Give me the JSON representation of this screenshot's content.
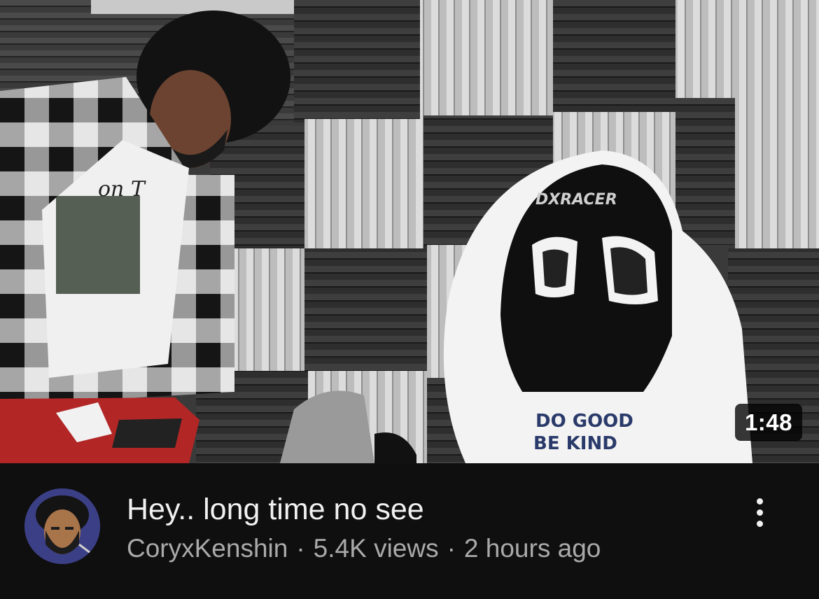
{
  "video": {
    "duration": "1:48",
    "title": "Hey.. long time no see",
    "channel": "CoryxKenshin",
    "views": "5.4K views",
    "age": "2 hours ago",
    "separator": "·"
  },
  "thumbnail": {
    "chair_brand": "DXRACER",
    "chair_text_line1": "DO GOOD",
    "chair_text_line2": "BE KIND",
    "shirt_text": "on T"
  },
  "icons": {
    "menu": "more-vert-icon",
    "avatar": "channel-avatar"
  },
  "colors": {
    "background": "#0f0f0f",
    "title": "#f1f1f1",
    "subtext": "#aaaaaa",
    "avatar_bg": "#3b3f86"
  }
}
